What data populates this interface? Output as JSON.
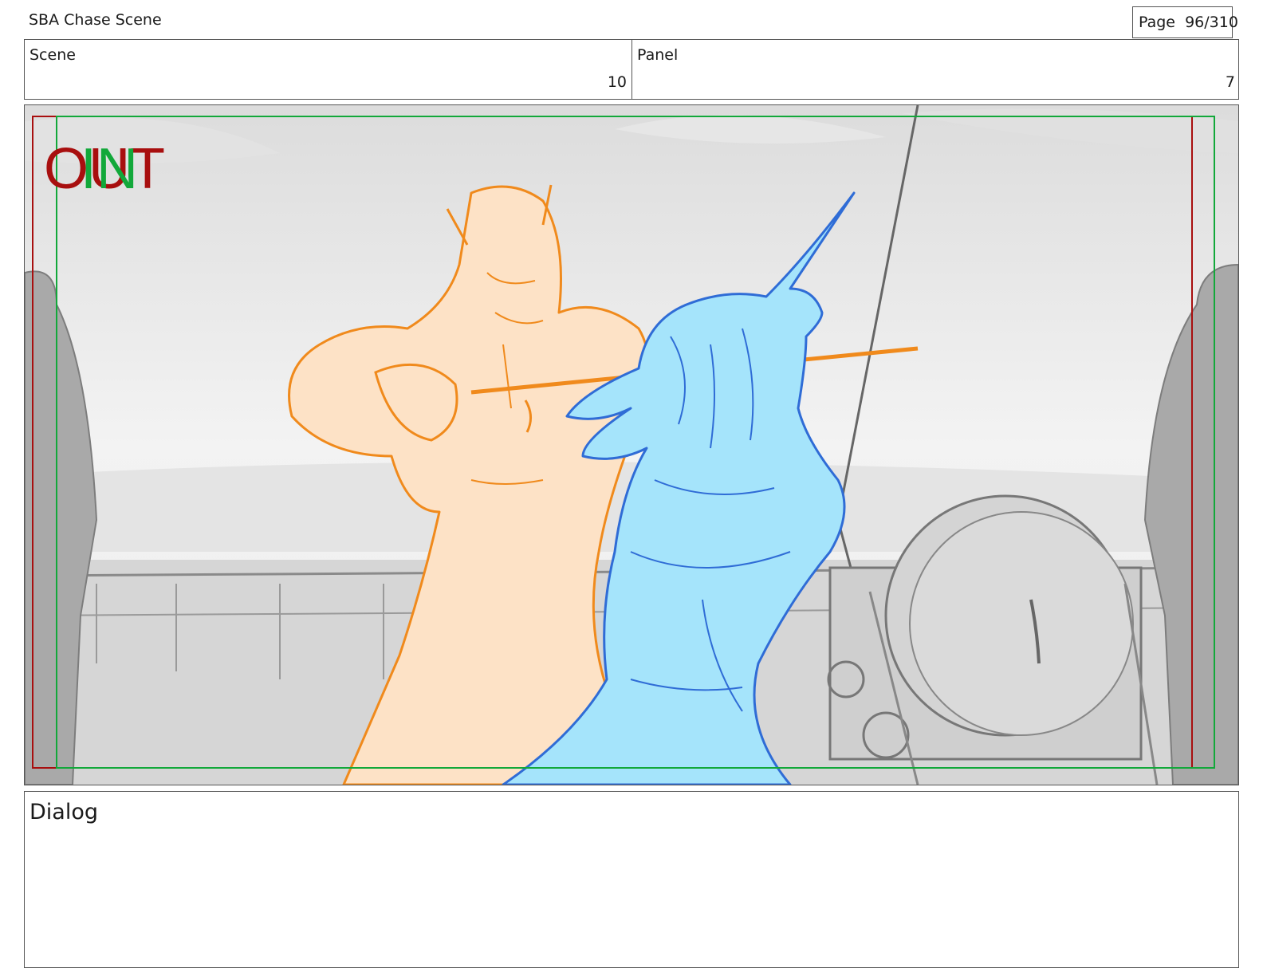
{
  "header": {
    "title": "SBA Chase Scene",
    "page_label": "Page",
    "page_value": "96/310"
  },
  "info": {
    "scene_label": "Scene",
    "scene_value": "10",
    "panel_label": "Panel",
    "panel_value": "7"
  },
  "frame": {
    "markers": {
      "out": "OUT",
      "in": "IN"
    },
    "colors": {
      "out_marker": "#a80f0f",
      "in_marker": "#12a83a",
      "character_orange_line": "#f08a1c",
      "character_orange_fill": "#fde2c6",
      "character_blue_line": "#2f6cd6",
      "character_blue_fill": "#a5e4fb",
      "background_sketch": "#7d7d7d"
    }
  },
  "dialog": {
    "label": "Dialog"
  }
}
